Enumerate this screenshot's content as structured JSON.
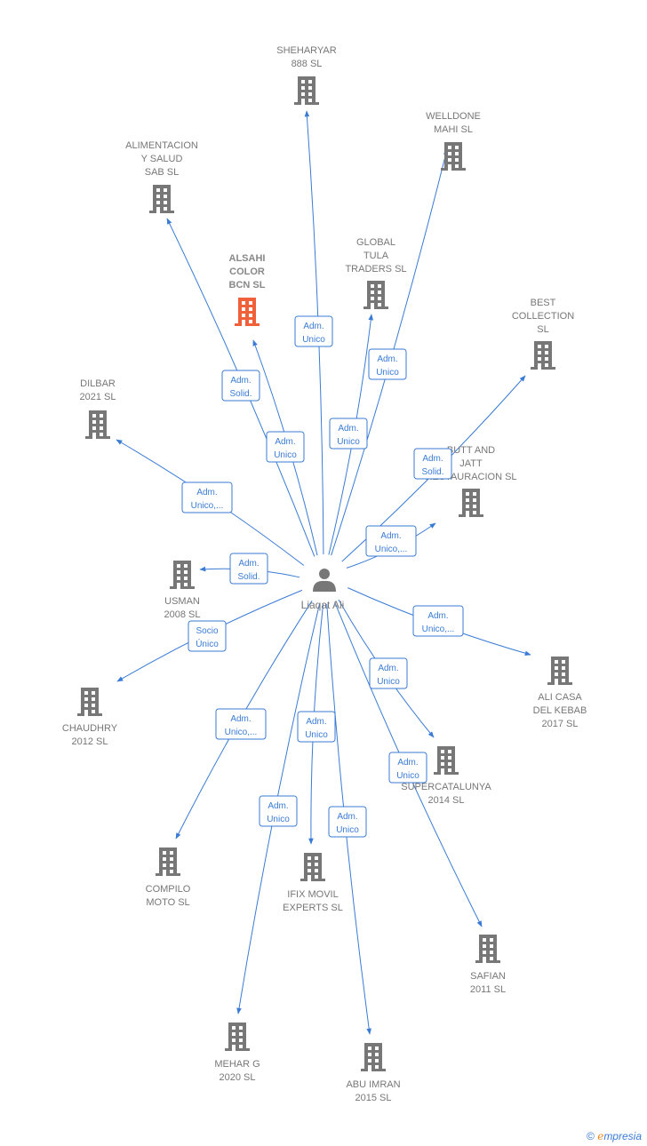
{
  "center": {
    "name": "Liaqat Ali",
    "icon": "person-icon"
  },
  "colors": {
    "edge": "#3a7bd5",
    "building": "#777777",
    "highlight": "#f0603a",
    "label": "#777777"
  },
  "nodes": [
    {
      "id": "sheharyar",
      "lines": [
        "SHEHARYAR",
        "888  SL"
      ],
      "edge": [
        "Adm.",
        "Unico"
      ]
    },
    {
      "id": "welldone",
      "lines": [
        "WELLDONE",
        "MAHI  SL"
      ],
      "edge": [
        "Adm.",
        "Unico"
      ]
    },
    {
      "id": "alimentacion",
      "lines": [
        "ALIMENTACION",
        "Y SALUD",
        "SAB  SL"
      ],
      "edge": [
        "Adm.",
        "Solid."
      ]
    },
    {
      "id": "global",
      "lines": [
        "GLOBAL",
        "TULA",
        "TRADERS SL"
      ],
      "edge": [
        "Adm.",
        "Unico"
      ]
    },
    {
      "id": "alsahi",
      "lines": [
        "ALSAHI",
        "COLOR",
        "BCN  SL"
      ],
      "edge": [
        "Adm.",
        "Unico"
      ],
      "highlight": true
    },
    {
      "id": "best",
      "lines": [
        "BEST",
        "COLLECTION",
        "SL"
      ],
      "edge": [
        "Adm.",
        "Solid."
      ]
    },
    {
      "id": "dilbar",
      "lines": [
        "DILBAR",
        "2021  SL"
      ],
      "edge": [
        "Adm.",
        "Unico,..."
      ]
    },
    {
      "id": "butt",
      "lines": [
        "BUTT AND",
        "JATT",
        "RESTAURACION SL"
      ],
      "edge": [
        "Adm.",
        "Unico,..."
      ]
    },
    {
      "id": "usman",
      "lines": [
        "USMAN",
        "2008 SL"
      ],
      "edge": [
        "Adm.",
        "Solid."
      ]
    },
    {
      "id": "chaudhry",
      "lines": [
        "CHAUDHRY",
        "2012 SL"
      ],
      "edge": [
        "Socio",
        "Único"
      ]
    },
    {
      "id": "alicasa",
      "lines": [
        "ALI CASA",
        "DEL KEBAB",
        "2017  SL"
      ],
      "edge": [
        "Adm.",
        "Unico,..."
      ]
    },
    {
      "id": "supercat",
      "lines": [
        "SUPERCATALUNYA",
        "2014  SL"
      ],
      "edge": [
        "Adm.",
        "Unico"
      ]
    },
    {
      "id": "compilo",
      "lines": [
        "COMPILO",
        "MOTO  SL"
      ],
      "edge": [
        "Adm.",
        "Unico,..."
      ]
    },
    {
      "id": "ifix",
      "lines": [
        "IFIX MOVIL",
        "EXPERTS  SL"
      ],
      "edge": [
        "Adm.",
        "Unico"
      ]
    },
    {
      "id": "safian",
      "lines": [
        "SAFIAN",
        "2011 SL"
      ],
      "edge": [
        "Adm.",
        "Unico"
      ]
    },
    {
      "id": "mehar",
      "lines": [
        "MEHAR G",
        "2020  SL"
      ],
      "edge": [
        "Adm.",
        "Unico"
      ]
    },
    {
      "id": "abu",
      "lines": [
        "ABU IMRAN",
        "2015  SL"
      ],
      "edge": [
        "Adm.",
        "Unico"
      ]
    }
  ],
  "footer": {
    "copyright": "©",
    "brand_e": "e",
    "brand_rest": "mpresia"
  }
}
